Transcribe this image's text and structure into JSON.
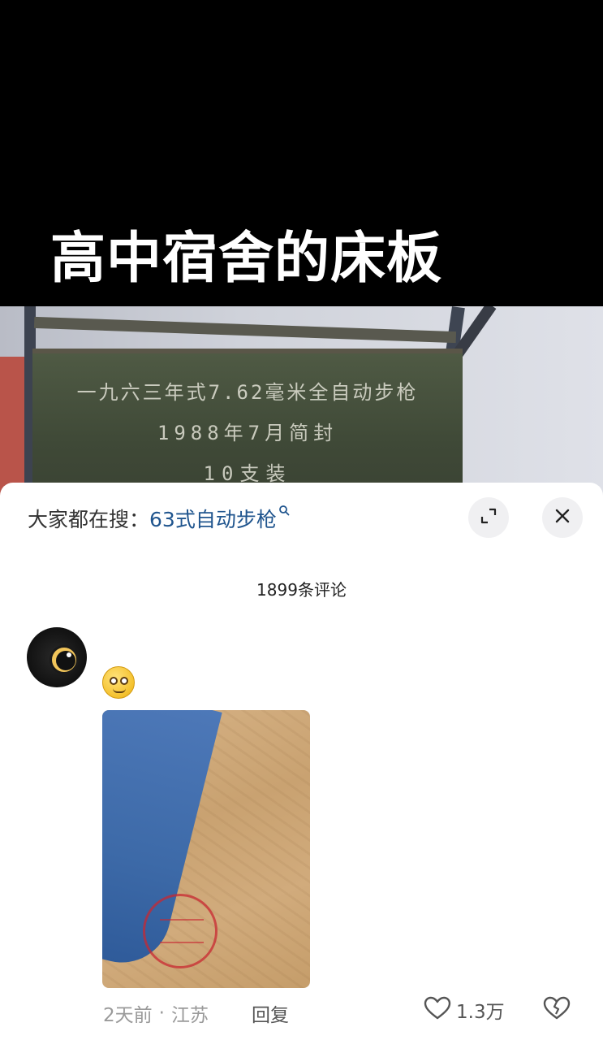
{
  "video": {
    "caption": "高中宿舍的床板",
    "stencil_lines": [
      "一九六三年式7.62毫米全自动步枪",
      "1988年7月简封",
      "10支装"
    ]
  },
  "search_bar": {
    "prefix": "大家都在搜：",
    "term": "63式自动步枪",
    "icons": [
      "search-icon",
      "expand-icon",
      "close-icon"
    ]
  },
  "comments_header": {
    "count_label": "1899条评论"
  },
  "comment": {
    "avatar": "avatar",
    "emoji": "smiling-face-emoji",
    "image": "comment-photo",
    "time": "2天前",
    "separator": "·",
    "location": "江苏",
    "reply_label": "回复",
    "like_count": "1.3万",
    "icons": [
      "heart-icon",
      "broken-heart-icon"
    ]
  },
  "colors": {
    "accent_link": "#20558e",
    "sheet_bg": "#ffffff",
    "muted_text": "#9a9a9a"
  }
}
